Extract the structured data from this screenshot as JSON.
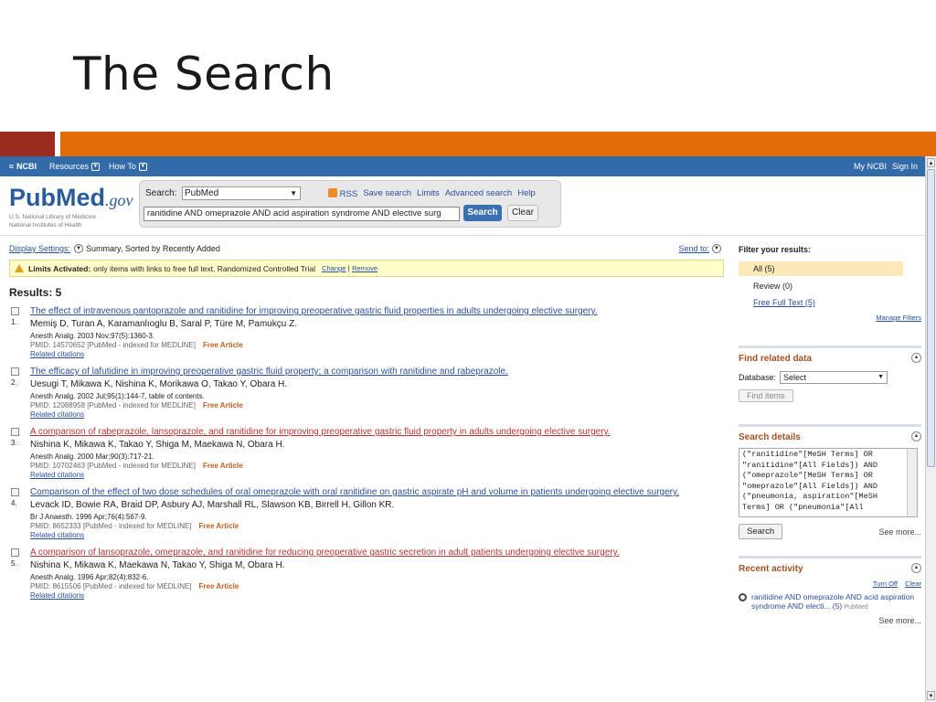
{
  "slide": {
    "title": "The Search"
  },
  "ncbi_bar": {
    "logo": "NCBI",
    "resources": "Resources",
    "howto": "How To",
    "my_ncbi": "My NCBI",
    "sign_in": "Sign In"
  },
  "header": {
    "logo_word": "PubMed",
    "logo_gov": ".gov",
    "logo_sub1": "U.S. National Library of Medicine",
    "logo_sub2": "National Institutes of Health",
    "search_label": "Search:",
    "database": "PubMed",
    "links": [
      "RSS",
      "Save search",
      "Limits",
      "Advanced search",
      "Help"
    ],
    "query": "ranitidine AND omeprazole AND acid aspiration syndrome AND elective surg",
    "search_button": "Search",
    "clear_button": "Clear"
  },
  "display": {
    "settings_link": "Display Settings:",
    "settings_value": "Summary, Sorted by Recently Added",
    "send_to": "Send to:"
  },
  "limits": {
    "label": "Limits Activated:",
    "text": "only items with links to free full text, Randomized Controlled Trial",
    "change": "Change",
    "remove": "Remove"
  },
  "results_header": "Results: 5",
  "results": [
    {
      "num": "1.",
      "title": "The effect of intravenous pantoprazole and ranitidine for improving preoperative gastric fluid properties in adults undergoing elective surgery.",
      "authors": "Memiş D, Turan A, Karamanlıoglu B, Saral P, Türe M, Pamukçu Z.",
      "journal": "Anesth Analg. 2003 Nov;97(5):1360-3.",
      "pmid": "PMID: 14570652 [PubMed - indexed for MEDLINE]",
      "free": "Free Article",
      "related": "Related citations"
    },
    {
      "num": "2.",
      "title": "The efficacy of lafutidine in improving preoperative gastric fluid property: a comparison with ranitidine and rabeprazole.",
      "authors": "Uesugi T, Mikawa K, Nishina K, Morikawa O, Takao Y, Obara H.",
      "journal": "Anesth Analg. 2002 Jul;95(1):144-7, table of contents.",
      "pmid": "PMID: 12088958 [PubMed - indexed for MEDLINE]",
      "free": "Free Article",
      "related": "Related citations"
    },
    {
      "num": "3.",
      "title": "A comparison of rabeprazole, lansoprazole, and ranitidine for improving preoperative gastric fluid property in adults undergoing elective surgery.",
      "authors": "Nishina K, Mikawa K, Takao Y, Shiga M, Maekawa N, Obara H.",
      "journal": "Anesth Analg. 2000 Mar;90(3):717-21.",
      "pmid": "PMID: 10702463 [PubMed - indexed for MEDLINE]",
      "free": "Free Article",
      "related": "Related citations"
    },
    {
      "num": "4.",
      "title": "Comparison of the effect of two dose schedules of oral omeprazole with oral ranitidine on gastric aspirate pH and volume in patients undergoing elective surgery.",
      "authors": "Levack ID, Bowie RA, Braid DP, Asbury AJ, Marshall RL, Slawson KB, Birrell H, Gillon KR.",
      "journal": "Br J Anaesth. 1996 Apr;76(4):567-9.",
      "pmid": "PMID: 8652333 [PubMed - indexed for MEDLINE]",
      "free": "Free Article",
      "related": "Related citations"
    },
    {
      "num": "5.",
      "title": "A comparison of lansoprazole, omeprazole, and ranitidine for reducing preoperative gastric secretion in adult patients undergoing elective surgery.",
      "authors": "Nishina K, Mikawa K, Maekawa N, Takao Y, Shiga M, Obara H.",
      "journal": "Anesth Analg. 1996 Apr;82(4):832-6.",
      "pmid": "PMID: 8615506 [PubMed - indexed for MEDLINE]",
      "free": "Free Article",
      "related": "Related citations"
    }
  ],
  "sidebar": {
    "filter_header": "Filter your results:",
    "filters": [
      "All (5)",
      "Review (0)",
      "Free Full Text (5)"
    ],
    "manage": "Manage Filters",
    "related_header": "Find related data",
    "database_label": "Database:",
    "database_value": "Select",
    "find_items": "Find items",
    "details_header": "Search details",
    "details_text": "(\"ranitidine\"[MeSH Terms] OR\n\"ranitidine\"[All Fields]) AND\n(\"omeprazole\"[MeSH Terms] OR\n\"omeprazole\"[All Fields]) AND\n(\"pneumonia, aspiration\"[MeSH\nTerms] OR (\"pneumonia\"[All",
    "details_search": "Search",
    "see_more": "See more...",
    "recent_header": "Recent activity",
    "turn_off": "Turn Off",
    "clear": "Clear",
    "recent_item": "ranitidine AND omeprazole AND acid aspiration syndrome AND electi... (5)",
    "recent_source": "PubMed",
    "recent_more": "See more..."
  }
}
